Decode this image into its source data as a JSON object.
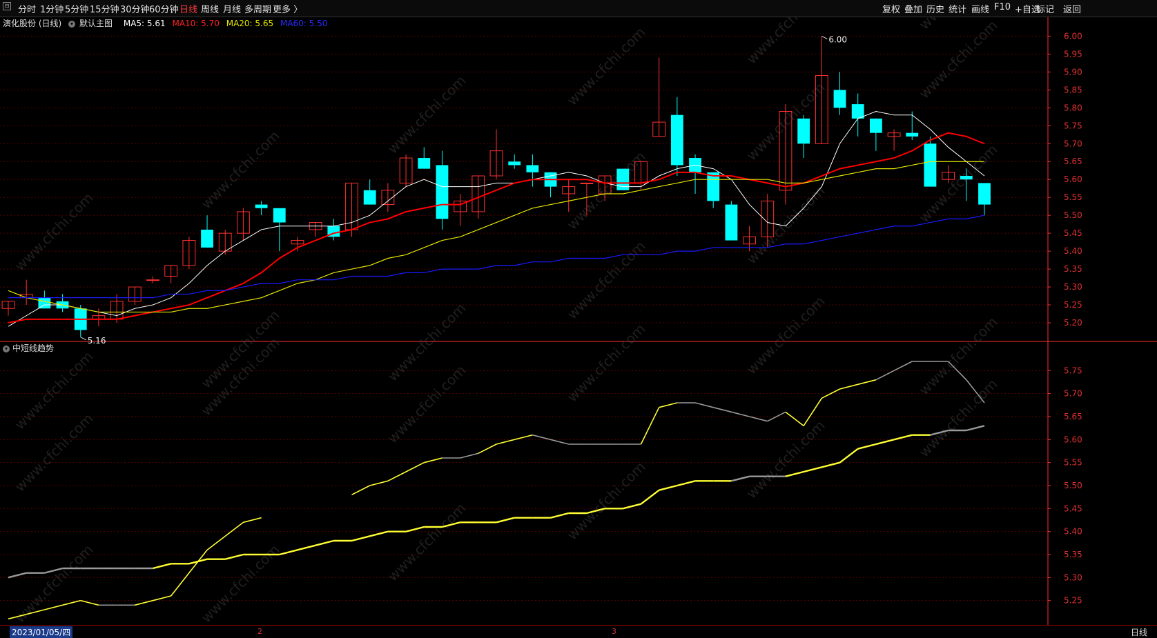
{
  "toolbar": {
    "left": [
      "分时",
      "1分钟",
      "5分钟",
      "15分钟",
      "30分钟",
      "60分钟",
      "日线",
      "周线",
      "月线",
      "多周期",
      "更多 〉"
    ],
    "active": "日线",
    "right": [
      "复权",
      "叠加",
      "历史",
      "统计",
      "画线",
      "F10",
      "+自选",
      "标记",
      "返回"
    ]
  },
  "main": {
    "title": "演化股份 (日线)",
    "template": "默认主图",
    "ma5": "MA5: 5.61",
    "ma10": "MA10: 5.70",
    "ma20": "MA20: 5.65",
    "ma60": "MA60: 5.50"
  },
  "colors": {
    "up": "#ff3030",
    "down": "#00ffff",
    "ma5": "#ffffff",
    "ma10": "#ff0000",
    "ma20": "#e6e600",
    "ma60": "#1a1aff",
    "grid": "#5a0000",
    "axis": "#ff3030",
    "trend_yellow": "#ffff33",
    "trend_gray": "#9a9a9a"
  },
  "sub": {
    "title": "中短线趋势"
  },
  "footer": {
    "date": "2023/01/05/四",
    "period": "日线",
    "month_marks": [
      "2",
      "3"
    ]
  },
  "watermark": "www.cfchi.com",
  "chart_data": [
    {
      "type": "candlestick",
      "ylim": [
        5.15,
        6.02
      ],
      "y_ticks": [
        "6.00",
        "5.95",
        "5.90",
        "5.85",
        "5.80",
        "5.75",
        "5.70",
        "5.65",
        "5.60",
        "5.55",
        "5.50",
        "5.45",
        "5.40",
        "5.35",
        "5.30",
        "5.25",
        "5.20"
      ],
      "annotations": {
        "high": "6.00",
        "low": "5.16"
      },
      "ohlc": [
        [
          5.24,
          5.26,
          5.22,
          5.26
        ],
        [
          5.27,
          5.32,
          5.25,
          5.28
        ],
        [
          5.27,
          5.29,
          5.24,
          5.24
        ],
        [
          5.26,
          5.28,
          5.23,
          5.24
        ],
        [
          5.24,
          5.25,
          5.16,
          5.18
        ],
        [
          5.21,
          5.24,
          5.19,
          5.22
        ],
        [
          5.21,
          5.28,
          5.2,
          5.26
        ],
        [
          5.26,
          5.3,
          5.25,
          5.3
        ],
        [
          5.32,
          5.33,
          5.31,
          5.32
        ],
        [
          5.33,
          5.36,
          5.31,
          5.36
        ],
        [
          5.36,
          5.44,
          5.35,
          5.43
        ],
        [
          5.46,
          5.5,
          5.41,
          5.41
        ],
        [
          5.4,
          5.46,
          5.39,
          5.45
        ],
        [
          5.45,
          5.52,
          5.43,
          5.51
        ],
        [
          5.53,
          5.54,
          5.5,
          5.52
        ],
        [
          5.52,
          5.52,
          5.4,
          5.48
        ],
        [
          5.42,
          5.44,
          5.4,
          5.43
        ],
        [
          5.46,
          5.48,
          5.44,
          5.48
        ],
        [
          5.47,
          5.49,
          5.43,
          5.44
        ],
        [
          5.46,
          5.59,
          5.44,
          5.59
        ],
        [
          5.57,
          5.6,
          5.53,
          5.53
        ],
        [
          5.53,
          5.59,
          5.51,
          5.57
        ],
        [
          5.59,
          5.67,
          5.58,
          5.66
        ],
        [
          5.66,
          5.69,
          5.63,
          5.63
        ],
        [
          5.64,
          5.68,
          5.46,
          5.49
        ],
        [
          5.51,
          5.56,
          5.47,
          5.54
        ],
        [
          5.51,
          5.61,
          5.49,
          5.61
        ],
        [
          5.61,
          5.74,
          5.6,
          5.68
        ],
        [
          5.65,
          5.67,
          5.63,
          5.64
        ],
        [
          5.64,
          5.67,
          5.58,
          5.62
        ],
        [
          5.62,
          5.62,
          5.55,
          5.58
        ],
        [
          5.56,
          5.6,
          5.51,
          5.58
        ],
        [
          5.59,
          5.59,
          5.5,
          5.59
        ],
        [
          5.56,
          5.61,
          5.54,
          5.61
        ],
        [
          5.63,
          5.63,
          5.57,
          5.57
        ],
        [
          5.59,
          5.65,
          5.57,
          5.65
        ],
        [
          5.72,
          5.94,
          5.72,
          5.76
        ],
        [
          5.78,
          5.83,
          5.61,
          5.64
        ],
        [
          5.66,
          5.67,
          5.56,
          5.62
        ],
        [
          5.62,
          5.62,
          5.52,
          5.54
        ],
        [
          5.53,
          5.54,
          5.43,
          5.43
        ],
        [
          5.42,
          5.47,
          5.4,
          5.44
        ],
        [
          5.44,
          5.56,
          5.41,
          5.54
        ],
        [
          5.57,
          5.81,
          5.53,
          5.79
        ],
        [
          5.77,
          5.78,
          5.66,
          5.7
        ],
        [
          5.7,
          6.0,
          5.7,
          5.89
        ],
        [
          5.85,
          5.9,
          5.78,
          5.8
        ],
        [
          5.81,
          5.84,
          5.72,
          5.77
        ],
        [
          5.77,
          5.77,
          5.68,
          5.73
        ],
        [
          5.72,
          5.74,
          5.68,
          5.73
        ],
        [
          5.73,
          5.79,
          5.71,
          5.72
        ],
        [
          5.7,
          5.72,
          5.58,
          5.58
        ],
        [
          5.6,
          5.64,
          5.59,
          5.62
        ],
        [
          5.61,
          5.63,
          5.54,
          5.6
        ],
        [
          5.59,
          5.59,
          5.5,
          5.53
        ]
      ],
      "series": [
        {
          "name": "MA5",
          "values": [
            5.19,
            5.22,
            5.25,
            5.25,
            5.24,
            5.23,
            5.22,
            5.24,
            5.25,
            5.27,
            5.31,
            5.36,
            5.4,
            5.43,
            5.46,
            5.47,
            5.47,
            5.47,
            5.47,
            5.48,
            5.5,
            5.54,
            5.58,
            5.6,
            5.58,
            5.58,
            5.58,
            5.59,
            5.59,
            5.6,
            5.61,
            5.62,
            5.61,
            5.59,
            5.58,
            5.58,
            5.61,
            5.63,
            5.64,
            5.63,
            5.6,
            5.53,
            5.48,
            5.47,
            5.52,
            5.58,
            5.7,
            5.77,
            5.79,
            5.78,
            5.78,
            5.74,
            5.69,
            5.65,
            5.61
          ]
        },
        {
          "name": "MA10",
          "values": [
            5.2,
            5.21,
            5.21,
            5.21,
            5.21,
            5.21,
            5.21,
            5.22,
            5.23,
            5.24,
            5.25,
            5.27,
            5.29,
            5.31,
            5.34,
            5.38,
            5.41,
            5.43,
            5.45,
            5.46,
            5.48,
            5.49,
            5.51,
            5.52,
            5.53,
            5.53,
            5.55,
            5.57,
            5.59,
            5.6,
            5.6,
            5.6,
            5.6,
            5.59,
            5.59,
            5.59,
            5.6,
            5.62,
            5.62,
            5.61,
            5.61,
            5.6,
            5.59,
            5.58,
            5.59,
            5.61,
            5.63,
            5.64,
            5.65,
            5.66,
            5.68,
            5.71,
            5.73,
            5.72,
            5.7
          ]
        },
        {
          "name": "MA20",
          "values": [
            5.29,
            5.27,
            5.26,
            5.25,
            5.24,
            5.23,
            5.23,
            5.23,
            5.23,
            5.23,
            5.24,
            5.24,
            5.25,
            5.26,
            5.27,
            5.29,
            5.31,
            5.32,
            5.34,
            5.35,
            5.36,
            5.38,
            5.39,
            5.41,
            5.43,
            5.44,
            5.46,
            5.48,
            5.5,
            5.52,
            5.53,
            5.54,
            5.55,
            5.56,
            5.56,
            5.57,
            5.58,
            5.59,
            5.6,
            5.6,
            5.6,
            5.6,
            5.6,
            5.59,
            5.59,
            5.6,
            5.61,
            5.62,
            5.63,
            5.63,
            5.64,
            5.65,
            5.65,
            5.65,
            5.65
          ]
        },
        {
          "name": "MA60",
          "values": [
            5.27,
            5.27,
            5.27,
            5.27,
            5.27,
            5.27,
            5.27,
            5.27,
            5.27,
            5.28,
            5.28,
            5.29,
            5.29,
            5.3,
            5.31,
            5.31,
            5.32,
            5.32,
            5.32,
            5.33,
            5.33,
            5.33,
            5.34,
            5.34,
            5.35,
            5.35,
            5.35,
            5.36,
            5.36,
            5.37,
            5.37,
            5.38,
            5.38,
            5.38,
            5.39,
            5.39,
            5.39,
            5.4,
            5.4,
            5.41,
            5.41,
            5.41,
            5.41,
            5.42,
            5.42,
            5.43,
            5.44,
            5.45,
            5.46,
            5.47,
            5.47,
            5.48,
            5.49,
            5.49,
            5.5
          ]
        }
      ]
    },
    {
      "type": "line",
      "title": "中短线趋势",
      "ylim": [
        5.2,
        5.8
      ],
      "y_ticks": [
        "5.75",
        "5.70",
        "5.65",
        "5.60",
        "5.55",
        "5.50",
        "5.45",
        "5.40",
        "5.35",
        "5.30",
        "5.25"
      ],
      "series": [
        {
          "values": [
            5.21,
            5.22,
            5.23,
            5.24,
            5.25,
            5.24,
            5.24,
            5.24,
            5.25,
            5.26,
            5.31,
            5.36,
            5.39,
            5.42,
            5.43,
            null,
            null,
            null,
            null,
            5.48,
            5.5,
            5.51,
            5.53,
            5.55,
            5.56,
            5.56,
            5.57,
            5.59,
            5.6,
            5.61,
            5.6,
            5.59,
            5.59,
            5.59,
            5.59,
            5.59,
            5.67,
            5.68,
            5.68,
            5.67,
            5.66,
            5.65,
            5.64,
            5.66,
            5.63,
            5.69,
            5.71,
            5.72,
            5.73,
            5.75,
            5.77,
            5.77,
            5.77,
            5.73,
            5.68
          ],
          "colors": [
            "y",
            "y",
            "y",
            "y",
            "y",
            "g",
            "g",
            "y",
            "y",
            "y",
            "y",
            "y",
            "y",
            "y",
            "y",
            "g",
            "g",
            "g",
            "g",
            "y",
            "y",
            "y",
            "y",
            "y",
            "g",
            "g",
            "y",
            "y",
            "y",
            "g",
            "g",
            "g",
            "g",
            "g",
            "g",
            "y",
            "y",
            "g",
            "g",
            "g",
            "g",
            "g",
            "g",
            "y",
            "y",
            "y",
            "y",
            "y",
            "g",
            "g",
            "g",
            "g",
            "g",
            "g",
            "g"
          ]
        },
        {
          "values": [
            5.3,
            5.31,
            5.31,
            5.32,
            5.32,
            5.32,
            5.32,
            5.32,
            5.32,
            5.33,
            5.33,
            5.34,
            5.34,
            5.35,
            5.35,
            5.35,
            5.36,
            5.37,
            5.38,
            5.38,
            5.39,
            5.4,
            5.4,
            5.41,
            5.41,
            5.42,
            5.42,
            5.42,
            5.43,
            5.43,
            5.43,
            5.44,
            5.44,
            5.45,
            5.45,
            5.46,
            5.49,
            5.5,
            5.51,
            5.51,
            5.51,
            5.52,
            5.52,
            5.52,
            5.53,
            5.54,
            5.55,
            5.58,
            5.59,
            5.6,
            5.61,
            5.61,
            5.62,
            5.62,
            5.63
          ],
          "colors": [
            "g",
            "g",
            "g",
            "g",
            "g",
            "g",
            "g",
            "g",
            "y",
            "y",
            "y",
            "y",
            "y",
            "y",
            "y",
            "y",
            "y",
            "y",
            "y",
            "y",
            "y",
            "y",
            "y",
            "y",
            "y",
            "y",
            "y",
            "y",
            "y",
            "y",
            "y",
            "y",
            "y",
            "y",
            "y",
            "y",
            "y",
            "y",
            "y",
            "y",
            "g",
            "g",
            "g",
            "y",
            "y",
            "y",
            "y",
            "y",
            "y",
            "y",
            "y",
            "g",
            "g",
            "g",
            "g"
          ]
        }
      ]
    }
  ]
}
